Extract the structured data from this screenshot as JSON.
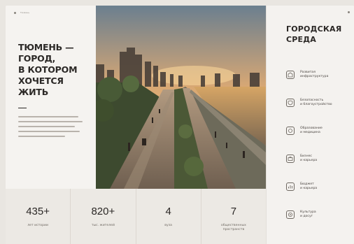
{
  "topbar": {
    "brand": "Тюмень"
  },
  "hero": {
    "title": "Тюмень — город, в котором хочется жить",
    "title_lines": [
      "ТЮМЕНЬ —",
      "ГОРОД,",
      "В КОТОРОМ",
      "ХОЧЕТСЯ ЖИТЬ"
    ]
  },
  "right": {
    "title_lines": [
      "ГОРОДСКАЯ",
      "СРЕДА"
    ],
    "items": [
      {
        "icon": "building-icon",
        "lines": [
          "Развитая",
          "инфраструктура"
        ]
      },
      {
        "icon": "shield-icon",
        "lines": [
          "Безопасность",
          "и благоустройство"
        ]
      },
      {
        "icon": "graduation-icon",
        "lines": [
          "Образование",
          "и медицина"
        ]
      },
      {
        "icon": "briefcase-icon",
        "lines": [
          "Бизнес",
          "и карьера"
        ]
      },
      {
        "icon": "chart-icon",
        "lines": [
          "Бюджет",
          "и карьера"
        ]
      },
      {
        "icon": "theater-icon",
        "lines": [
          "Культура",
          "и досуг"
        ]
      }
    ]
  },
  "stats": [
    {
      "value": "435+",
      "label": "лет истории"
    },
    {
      "value": "820+",
      "label": "тыс. жителей"
    },
    {
      "value": "4",
      "label": "вуза"
    },
    {
      "value": "7",
      "label": "общественных пространств"
    }
  ],
  "colors": {
    "accent": "#2b2826",
    "panel": "#f5f3f0",
    "stats_bg": "#ece9e4"
  }
}
